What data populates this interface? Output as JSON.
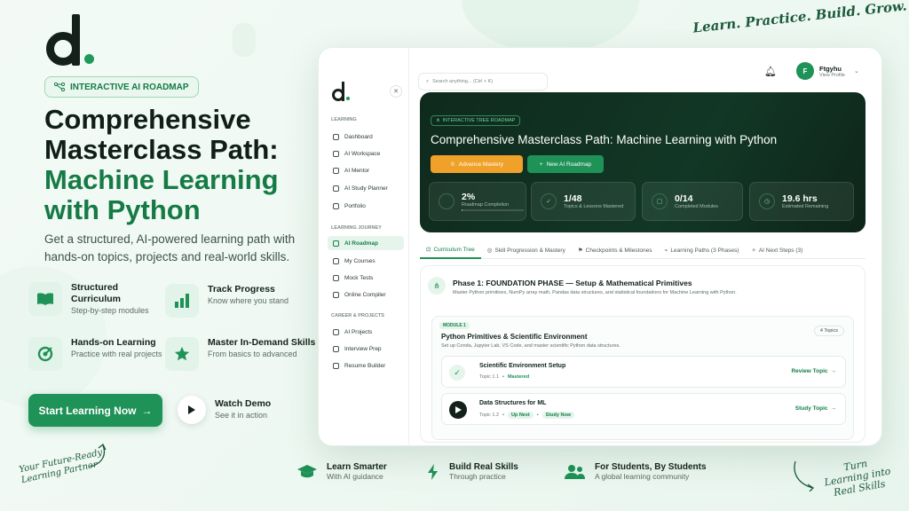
{
  "tagline_top": "Learn. Practice. Build. Grow.",
  "badge": "INTERACTIVE AI ROADMAP",
  "headline": {
    "line1": "Comprehensive",
    "line2": "Masterclass Path:",
    "line3": "Machine Learning",
    "line4": "with Python"
  },
  "subtitle": "Get a structured, AI-powered learning path with hands-on topics, projects and real-world skills.",
  "features": [
    {
      "title": "Structured Curriculum",
      "desc": "Step-by-step modules"
    },
    {
      "title": "Track Progress",
      "desc": "Know where you stand"
    },
    {
      "title": "Hands-on Learning",
      "desc": "Practice with real projects"
    },
    {
      "title": "Master In-Demand Skills",
      "desc": "From basics to advanced"
    }
  ],
  "cta": {
    "start": "Start Learning Now",
    "watch_title": "Watch Demo",
    "watch_desc": "See it in action"
  },
  "hand_left": "Your Future-Ready Learning Partner",
  "hand_right": "Turn Learning into Real Skills",
  "bottom": [
    {
      "title": "Learn Smarter",
      "desc": "With AI guidance"
    },
    {
      "title": "Build Real Skills",
      "desc": "Through practice"
    },
    {
      "title": "For Students, By Students",
      "desc": "A global learning community"
    }
  ],
  "app": {
    "search_placeholder": "Search anything... (Ctrl + K)",
    "user": {
      "initial": "F",
      "name": "Ftgyhu",
      "sub": "View Profile"
    },
    "sidebar": {
      "sec_learning": "LEARNING",
      "learning": [
        "Dashboard",
        "AI Workspace",
        "AI Mentor",
        "AI Study Planner",
        "Portfolio"
      ],
      "sec_journey": "LEARNING JOURNEY",
      "journey": [
        "AI Roadmap",
        "My Courses",
        "Mock Tests",
        "Online Compiler"
      ],
      "sec_career": "CAREER & PROJECTS",
      "career": [
        "AI Projects",
        "Interview Prep",
        "Resume Builder"
      ]
    },
    "hero": {
      "tag": "INTERACTIVE TREE ROADMAP",
      "title": "Comprehensive Masterclass Path: Machine Learning with Python",
      "btn_advance": "Advance Mastery",
      "btn_new": "New AI Roadmap",
      "stats": [
        {
          "value": "2%",
          "label": "Roadmap Completion"
        },
        {
          "value": "1/48",
          "label": "Topics & Lessons Mastered"
        },
        {
          "value": "0/14",
          "label": "Completed Modules"
        },
        {
          "value": "19.6 hrs",
          "label": "Estimated Remaining"
        }
      ],
      "completion_fraction": 0.02
    },
    "tabs": [
      "Curriculum Tree",
      "Skill Progression & Mastery",
      "Checkpoints & Milestones",
      "Learning Paths (3 Phases)",
      "AI Next Steps (3)"
    ],
    "phase": {
      "title": "Phase 1: FOUNDATION PHASE — Setup & Mathematical Primitives",
      "desc": "Master Python primitives, NumPy array math, Pandas data structures, and statistical foundations for Machine Learning with Python."
    },
    "module": {
      "label": "MODULE 1",
      "title": "Python Primitives & Scientific Environment",
      "desc": "Set up Conda, Jupyter Lab, VS Code, and master scientific Python data structures.",
      "count": "4 Topics"
    },
    "topics": [
      {
        "title": "Scientific Environment Setup",
        "num": "Topic 1.1",
        "status": "Mastered",
        "action": "Review Topic"
      },
      {
        "title": "Data Structures for ML",
        "num": "Topic 1.2",
        "status": "Up Next",
        "status2": "Study Now",
        "action": "Study Topic"
      }
    ]
  }
}
